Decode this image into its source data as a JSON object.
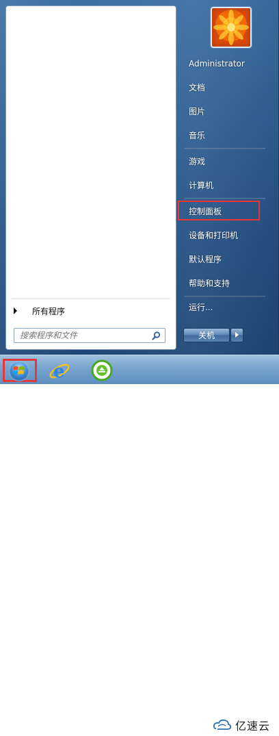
{
  "left_pane": {
    "all_programs_label": "所有程序",
    "search_placeholder": "搜索程序和文件"
  },
  "right_pane": {
    "items": [
      {
        "label": "Administrator"
      },
      {
        "label": "文档"
      },
      {
        "label": "图片"
      },
      {
        "label": "音乐"
      },
      {
        "label": "游戏"
      },
      {
        "label": "计算机"
      },
      {
        "label": "控制面板",
        "highlighted": true
      },
      {
        "label": "设备和打印机"
      },
      {
        "label": "默认程序"
      },
      {
        "label": "帮助和支持"
      },
      {
        "label": "运行..."
      }
    ],
    "shutdown_label": "关机"
  },
  "taskbar": {
    "icons": [
      "start-orb-icon",
      "internet-explorer-icon",
      "refresh-app-icon"
    ]
  },
  "watermark": {
    "text": "亿速云"
  },
  "colors": {
    "highlight_border": "#e33333"
  }
}
